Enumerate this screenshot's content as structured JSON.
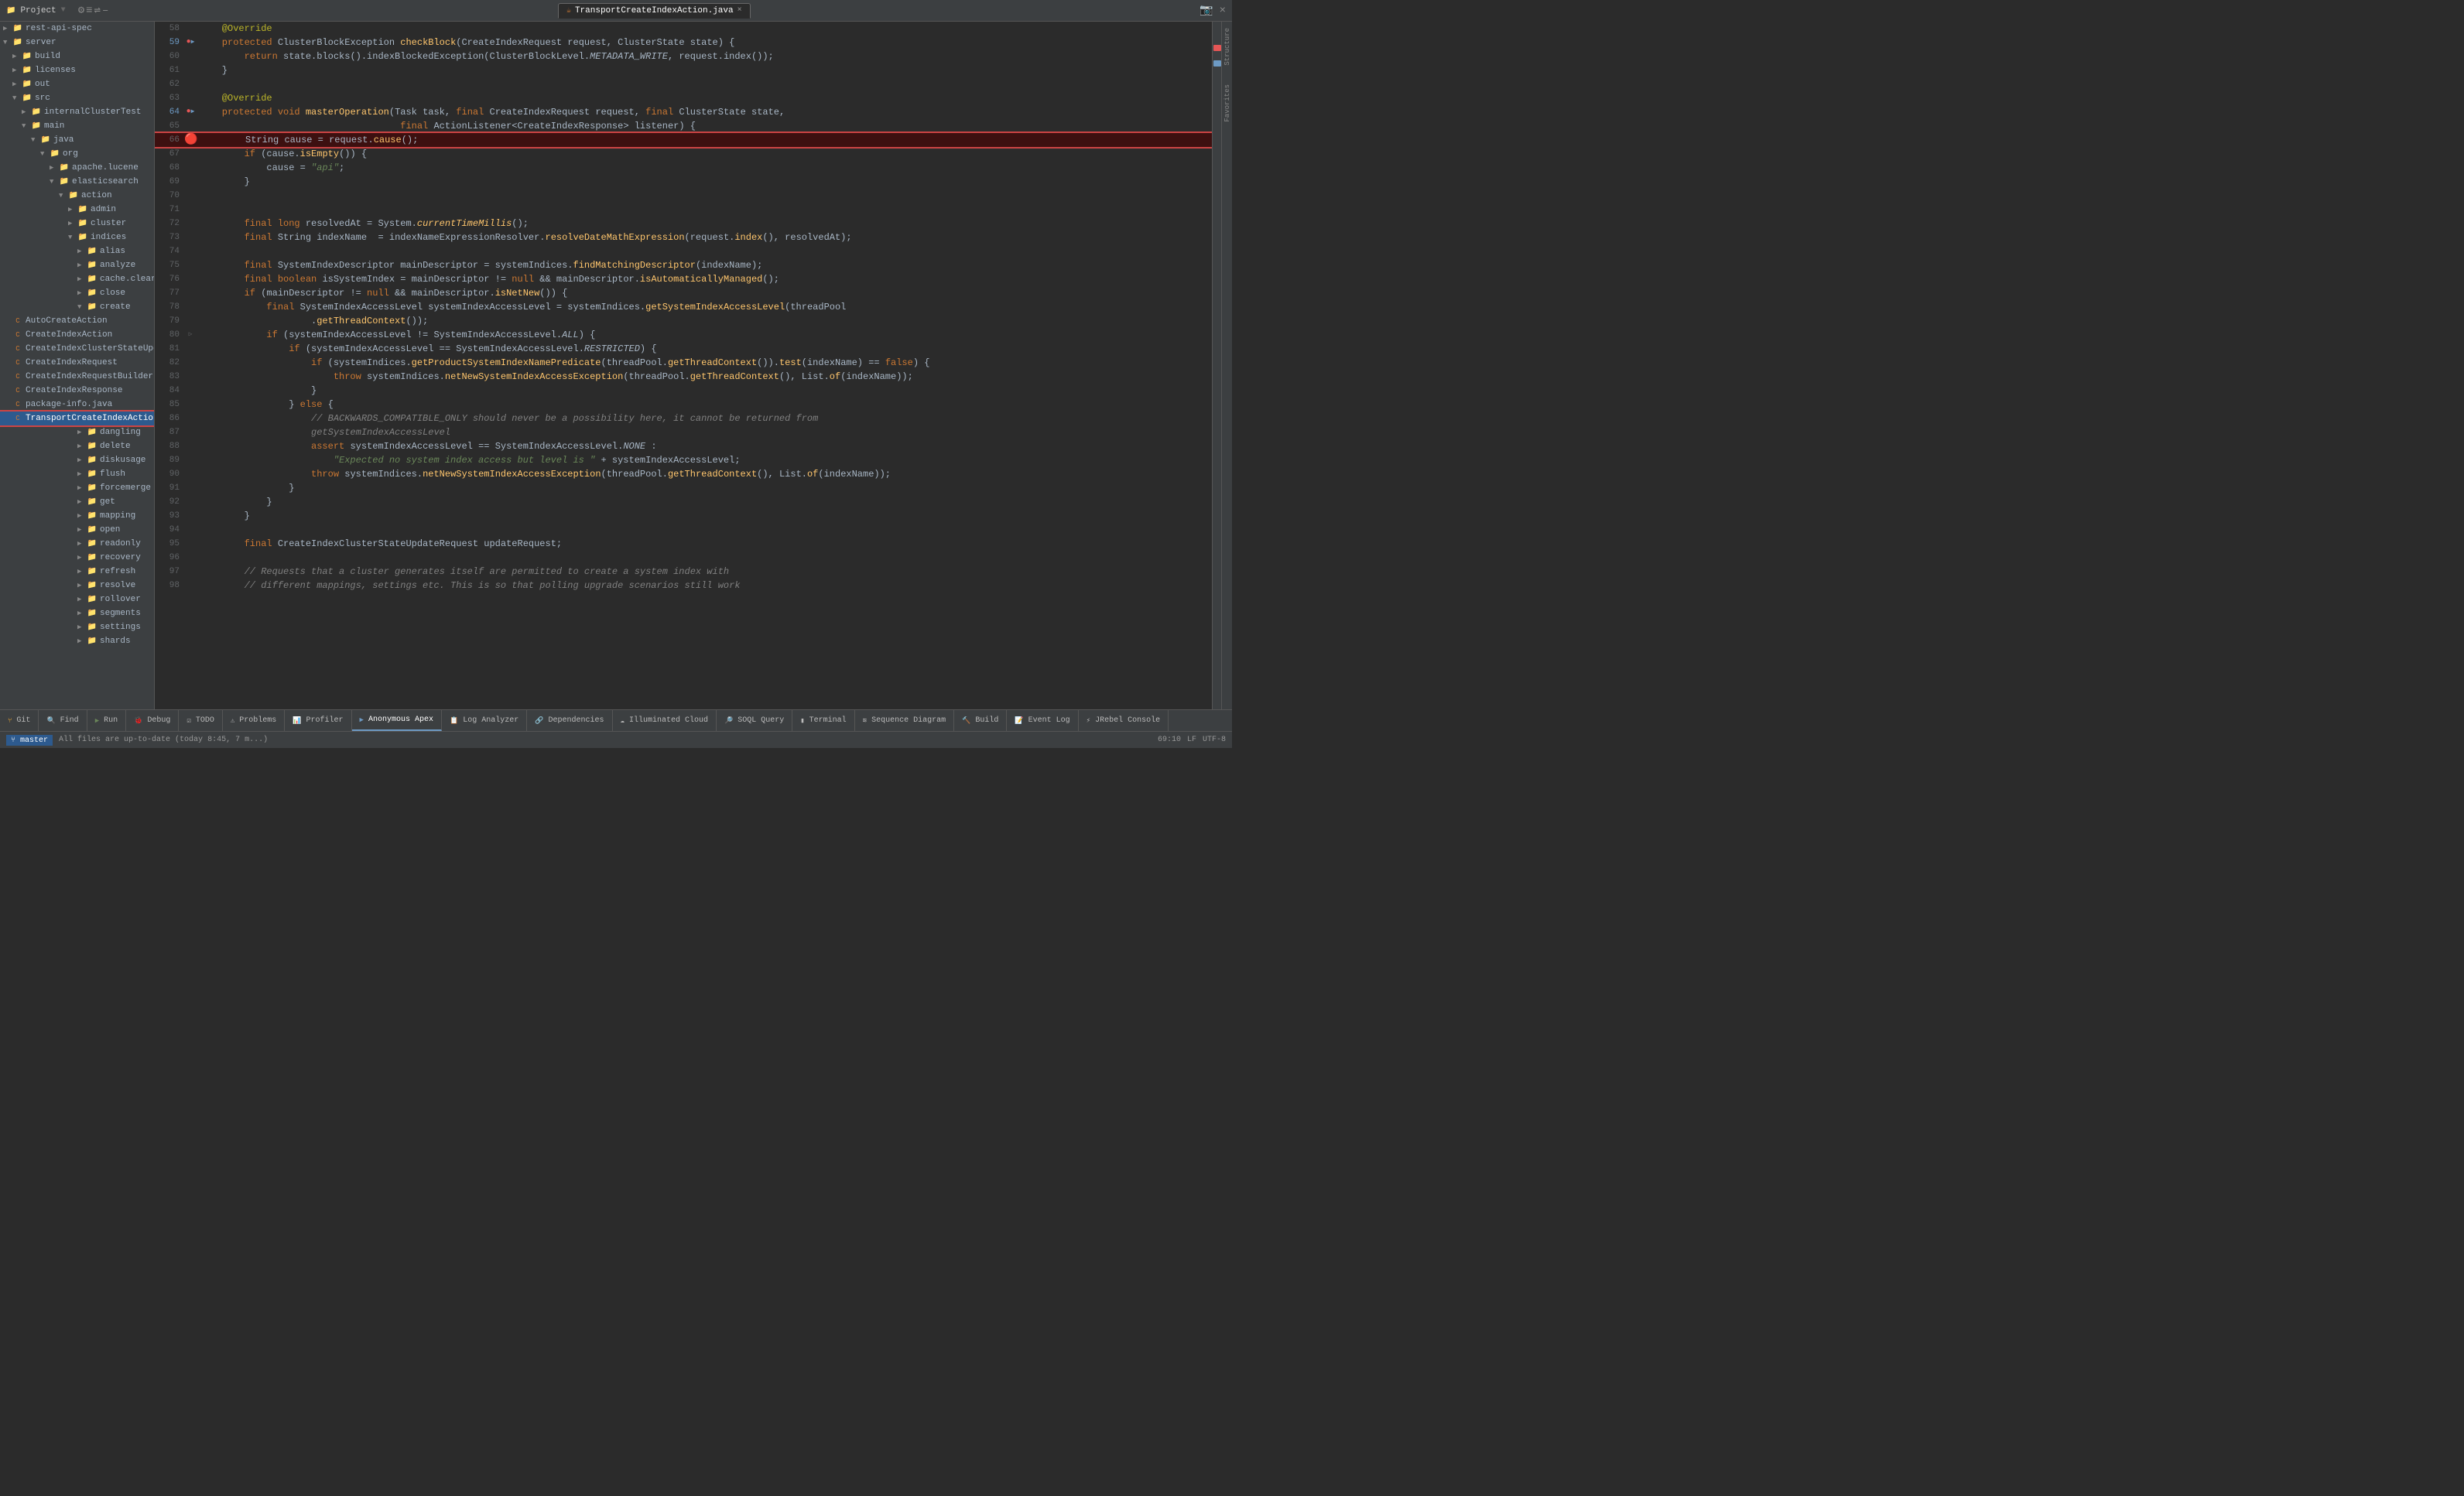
{
  "titlebar": {
    "project_label": "Project",
    "tab_filename": "TransportCreateIndexAction.java",
    "tab_close": "×"
  },
  "sidebar": {
    "items": [
      {
        "id": "rest-api-spec",
        "label": "rest-api-spec",
        "indent": 1,
        "type": "folder",
        "expanded": false
      },
      {
        "id": "server",
        "label": "server",
        "indent": 1,
        "type": "folder",
        "expanded": true
      },
      {
        "id": "build",
        "label": "build",
        "indent": 2,
        "type": "folder-yellow",
        "expanded": false
      },
      {
        "id": "licenses",
        "label": "licenses",
        "indent": 2,
        "type": "folder",
        "expanded": false
      },
      {
        "id": "out",
        "label": "out",
        "indent": 2,
        "type": "folder-yellow",
        "expanded": false
      },
      {
        "id": "src",
        "label": "src",
        "indent": 2,
        "type": "folder",
        "expanded": true
      },
      {
        "id": "internalClusterTest",
        "label": "internalClusterTest",
        "indent": 3,
        "type": "folder",
        "expanded": false
      },
      {
        "id": "main",
        "label": "main",
        "indent": 3,
        "type": "folder",
        "expanded": true
      },
      {
        "id": "java",
        "label": "java",
        "indent": 4,
        "type": "folder-blue",
        "expanded": true
      },
      {
        "id": "org",
        "label": "org",
        "indent": 5,
        "type": "folder",
        "expanded": true
      },
      {
        "id": "apache.lucene",
        "label": "apache.lucene",
        "indent": 6,
        "type": "folder",
        "expanded": false
      },
      {
        "id": "elasticsearch",
        "label": "elasticsearch",
        "indent": 6,
        "type": "folder",
        "expanded": true
      },
      {
        "id": "action",
        "label": "action",
        "indent": 7,
        "type": "folder",
        "expanded": true
      },
      {
        "id": "admin",
        "label": "admin",
        "indent": 8,
        "type": "folder",
        "expanded": false
      },
      {
        "id": "cluster",
        "label": "cluster",
        "indent": 8,
        "type": "folder",
        "expanded": false
      },
      {
        "id": "indices",
        "label": "indices",
        "indent": 8,
        "type": "folder",
        "expanded": true
      },
      {
        "id": "alias",
        "label": "alias",
        "indent": 9,
        "type": "folder",
        "expanded": false
      },
      {
        "id": "analyze",
        "label": "analyze",
        "indent": 9,
        "type": "folder",
        "expanded": false
      },
      {
        "id": "cache.clear",
        "label": "cache.clear",
        "indent": 9,
        "type": "folder",
        "expanded": false
      },
      {
        "id": "close",
        "label": "close",
        "indent": 9,
        "type": "folder",
        "expanded": false
      },
      {
        "id": "create",
        "label": "create",
        "indent": 9,
        "type": "folder",
        "expanded": true
      },
      {
        "id": "AutoCreateAction",
        "label": "AutoCreateAction",
        "indent": 10,
        "type": "java",
        "expanded": false
      },
      {
        "id": "CreateIndexAction",
        "label": "CreateIndexAction",
        "indent": 10,
        "type": "java",
        "expanded": false
      },
      {
        "id": "CreateIndexClusterStateUpdateR",
        "label": "CreateIndexClusterStateUpdateR",
        "indent": 10,
        "type": "java",
        "expanded": false
      },
      {
        "id": "CreateIndexRequest",
        "label": "CreateIndexRequest",
        "indent": 10,
        "type": "java",
        "expanded": false
      },
      {
        "id": "CreateIndexRequestBuilder",
        "label": "CreateIndexRequestBuilder",
        "indent": 10,
        "type": "java",
        "expanded": false
      },
      {
        "id": "CreateIndexResponse",
        "label": "CreateIndexResponse",
        "indent": 10,
        "type": "java",
        "expanded": false
      },
      {
        "id": "package-info.java",
        "label": "package-info.java",
        "indent": 10,
        "type": "java",
        "expanded": false
      },
      {
        "id": "TransportCreateIndexAction",
        "label": "TransportCreateIndexAction",
        "indent": 10,
        "type": "java",
        "expanded": false,
        "selected": true
      },
      {
        "id": "dangling",
        "label": "dangling",
        "indent": 9,
        "type": "folder",
        "expanded": false
      },
      {
        "id": "delete",
        "label": "delete",
        "indent": 9,
        "type": "folder",
        "expanded": false
      },
      {
        "id": "diskusage",
        "label": "diskusage",
        "indent": 9,
        "type": "folder",
        "expanded": false
      },
      {
        "id": "flush",
        "label": "flush",
        "indent": 9,
        "type": "folder",
        "expanded": false
      },
      {
        "id": "forcemerge",
        "label": "forcemerge",
        "indent": 9,
        "type": "folder",
        "expanded": false
      },
      {
        "id": "get",
        "label": "get",
        "indent": 9,
        "type": "folder",
        "expanded": false
      },
      {
        "id": "mapping",
        "label": "mapping",
        "indent": 9,
        "type": "folder",
        "expanded": false
      },
      {
        "id": "open",
        "label": "open",
        "indent": 9,
        "type": "folder",
        "expanded": false
      },
      {
        "id": "readonly",
        "label": "readonly",
        "indent": 9,
        "type": "folder",
        "expanded": false
      },
      {
        "id": "recovery",
        "label": "recovery",
        "indent": 9,
        "type": "folder",
        "expanded": false
      },
      {
        "id": "refresh",
        "label": "refresh",
        "indent": 9,
        "type": "folder",
        "expanded": false
      },
      {
        "id": "resolve",
        "label": "resolve",
        "indent": 9,
        "type": "folder",
        "expanded": false
      },
      {
        "id": "rollover",
        "label": "rollover",
        "indent": 9,
        "type": "folder",
        "expanded": false
      },
      {
        "id": "segments",
        "label": "segments",
        "indent": 9,
        "type": "folder",
        "expanded": false
      },
      {
        "id": "settings",
        "label": "settings",
        "indent": 9,
        "type": "folder",
        "expanded": false
      },
      {
        "id": "shards",
        "label": "shards",
        "indent": 9,
        "type": "folder",
        "expanded": false
      }
    ]
  },
  "editor": {
    "filename": "TransportCreateIndexAction.java",
    "lines": [
      {
        "num": 58,
        "gutter": "",
        "content": "    @Override"
      },
      {
        "num": 59,
        "gutter": "●▶",
        "content": "    protected ClusterBlockException checkBlock(CreateIndexRequest request, ClusterState state) {"
      },
      {
        "num": 60,
        "gutter": "",
        "content": "        return state.blocks().indexBlockedException(ClusterBlockLevel.METADATA_WRITE, request.index());"
      },
      {
        "num": 61,
        "gutter": "",
        "content": "    }"
      },
      {
        "num": 62,
        "gutter": "",
        "content": ""
      },
      {
        "num": 63,
        "gutter": "",
        "content": "    @Override"
      },
      {
        "num": 64,
        "gutter": "●▶",
        "content": "    protected void masterOperation(Task task, final CreateIndexRequest request, final ClusterState state,"
      },
      {
        "num": 65,
        "gutter": "",
        "content": "                                    final ActionListener<CreateIndexResponse> listener) {"
      },
      {
        "num": 66,
        "gutter": "🔴",
        "content": "        String cause = request.cause();",
        "highlighted": true,
        "boxed": true
      },
      {
        "num": 67,
        "gutter": "",
        "content": "        if (cause.isEmpty()) {"
      },
      {
        "num": 68,
        "gutter": "",
        "content": "            cause = \"api\";"
      },
      {
        "num": 69,
        "gutter": "",
        "content": "        }"
      },
      {
        "num": 70,
        "gutter": "",
        "content": ""
      },
      {
        "num": 71,
        "gutter": "",
        "content": ""
      },
      {
        "num": 72,
        "gutter": "",
        "content": "        final long resolvedAt = System.currentTimeMillis();"
      },
      {
        "num": 73,
        "gutter": "",
        "content": "        final String indexName = indexNameExpressionResolver.resolveDateMathExpression(request.index(), resolvedAt);"
      },
      {
        "num": 74,
        "gutter": "",
        "content": ""
      },
      {
        "num": 75,
        "gutter": "",
        "content": "        final SystemIndexDescriptor mainDescriptor = systemIndices.findMatchingDescriptor(indexName);"
      },
      {
        "num": 76,
        "gutter": "",
        "content": "        final boolean isSystemIndex = mainDescriptor != null && mainDescriptor.isAutomaticallyManaged();"
      },
      {
        "num": 77,
        "gutter": "",
        "content": "        if (mainDescriptor != null && mainDescriptor.isNetNew()) {"
      },
      {
        "num": 78,
        "gutter": "",
        "content": "            final SystemIndexAccessLevel systemIndexAccessLevel = systemIndices.getSystemIndexAccessLevel(threadPool"
      },
      {
        "num": 79,
        "gutter": "",
        "content": "                    .getThreadContext());"
      },
      {
        "num": 80,
        "gutter": "▷",
        "content": "            if (systemIndexAccessLevel != SystemIndexAccessLevel.ALL) {"
      },
      {
        "num": 81,
        "gutter": "",
        "content": "                if (systemIndexAccessLevel == SystemIndexAccessLevel.RESTRICTED) {"
      },
      {
        "num": 82,
        "gutter": "",
        "content": "                    if (systemIndices.getProductSystemIndexNamePredicate(threadPool.getThreadContext()).test(indexName) == false) {"
      },
      {
        "num": 83,
        "gutter": "",
        "content": "                        throw systemIndices.netNewSystemIndexAccessException(threadPool.getThreadContext(), List.of(indexName));"
      },
      {
        "num": 84,
        "gutter": "",
        "content": "                    }"
      },
      {
        "num": 85,
        "gutter": "",
        "content": "                } else {"
      },
      {
        "num": 86,
        "gutter": "",
        "content": "                    // BACKWARDS_COMPATIBLE_ONLY should never be a possibility here, it cannot be returned from"
      },
      {
        "num": 87,
        "gutter": "",
        "content": "                    getSystemIndexAccessLevel"
      },
      {
        "num": 88,
        "gutter": "",
        "content": "                    assert systemIndexAccessLevel == SystemIndexAccessLevel.NONE :"
      },
      {
        "num": 89,
        "gutter": "",
        "content": "                        \"Expected no system index access but level is \" + systemIndexAccessLevel;"
      },
      {
        "num": 90,
        "gutter": "",
        "content": "                    throw systemIndices.netNewSystemIndexAccessException(threadPool.getThreadContext(), List.of(indexName));"
      },
      {
        "num": 91,
        "gutter": "",
        "content": "                }"
      },
      {
        "num": 92,
        "gutter": "",
        "content": "            }"
      },
      {
        "num": 93,
        "gutter": "",
        "content": "        }"
      },
      {
        "num": 94,
        "gutter": "",
        "content": ""
      },
      {
        "num": 95,
        "gutter": "",
        "content": "        final CreateIndexClusterStateUpdateRequest updateRequest;"
      },
      {
        "num": 96,
        "gutter": "",
        "content": ""
      },
      {
        "num": 97,
        "gutter": "",
        "content": "        // Requests that a cluster generates itself are permitted to create a system index with"
      },
      {
        "num": 98,
        "gutter": "",
        "content": "        // different mappings, settings etc. This is so that polling upgrade scenarios still work"
      }
    ]
  },
  "bottom_tabs": [
    {
      "id": "git",
      "label": "Git",
      "icon": "git"
    },
    {
      "id": "find",
      "label": "Find",
      "icon": "find"
    },
    {
      "id": "run",
      "label": "Run",
      "icon": "run"
    },
    {
      "id": "debug",
      "label": "Debug",
      "icon": "debug"
    },
    {
      "id": "todo",
      "label": "TODO",
      "icon": "todo"
    },
    {
      "id": "problems",
      "label": "Problems",
      "icon": "problems"
    },
    {
      "id": "profiler",
      "label": "Profiler",
      "icon": "profiler"
    },
    {
      "id": "anonymous_apex",
      "label": "Anonymous Apex",
      "icon": "apex",
      "active": true
    },
    {
      "id": "log_analyzer",
      "label": "Log Analyzer",
      "icon": "log"
    },
    {
      "id": "dependencies",
      "label": "Dependencies",
      "icon": "dep"
    },
    {
      "id": "illuminated_cloud",
      "label": "Illuminated Cloud",
      "icon": "cloud"
    },
    {
      "id": "soql",
      "label": "SOQL Query",
      "icon": "soql"
    },
    {
      "id": "terminal",
      "label": "Terminal",
      "icon": "terminal"
    },
    {
      "id": "sequence_diagram",
      "label": "Sequence Diagram",
      "icon": "seq"
    },
    {
      "id": "build",
      "label": "Build",
      "icon": "build"
    },
    {
      "id": "event_log",
      "label": "Event Log",
      "icon": "event"
    },
    {
      "id": "jrebel",
      "label": "JRebel Console",
      "icon": "jrebel"
    }
  ],
  "statusbar": {
    "git_branch": "master",
    "position": "69:10",
    "encoding": "UTF-8",
    "line_separator": "LF",
    "status_msg": "All files are up-to-date (today 8:45, 7 m...)"
  }
}
